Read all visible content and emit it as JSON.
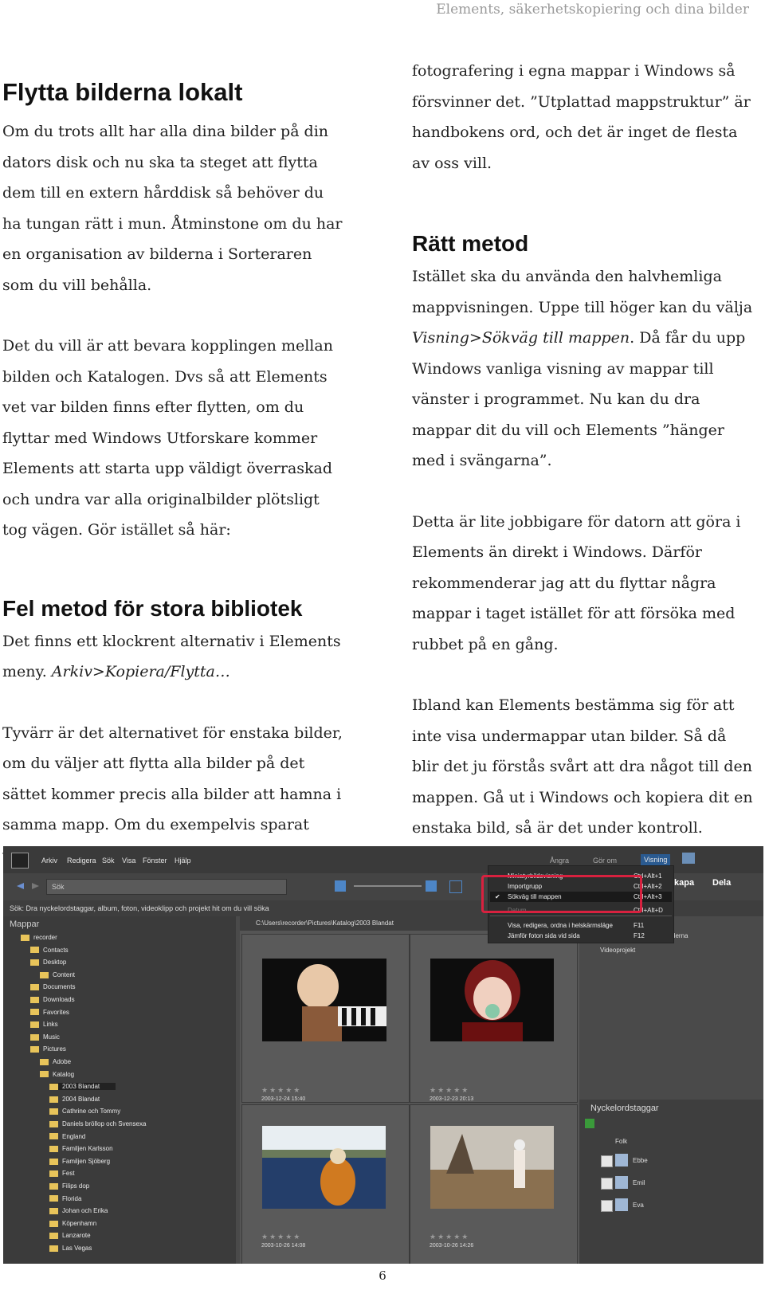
{
  "running_head": "Elements, säkerhetskopiering och dina bilder",
  "left": {
    "h1": "Flytta bilderna lokalt",
    "p1": "Om du trots allt har alla dina bilder på din dators disk och nu ska ta steget att flytta dem till en extern hårddisk så behöver du ha tungan rätt i mun. Åtminstone om du har en organisation av bilderna i Sorteraren som du vill behålla.",
    "p2": "Det du vill är att bevara kopplingen mellan bilden och Katalogen. Dvs så att Elements vet var bilden finns efter flytten, om du flyttar med Windows Utforskare kommer Elements att starta upp väldigt överraskad och undra var alla originalbilder plötsligt tog vägen. Gör istället så här:",
    "h2": "Fel metod för stora bibliotek",
    "p3a": "Det finns ett klockrent alternativ i Elements meny. ",
    "p3b": "Arkiv>Kopiera/Flytta…",
    "p4": "Tyvärr är det alternativet för enstaka bilder, om du väljer att flytta alla bilder på det sättet kommer precis alla bilder att hamna i samma mapp. Om du exempelvis sparat varje"
  },
  "right": {
    "p1": "fotografering i egna mappar i Windows så försvinner det. ”Utplattad mappstruktur” är handbokens ord, och det är inget de flesta av oss vill.",
    "h2": "Rätt metod",
    "p2a": "Istället ska du använda den halvhemliga mappvisningen. Uppe till höger kan du välja ",
    "p2b": "Visning>Sökväg till mappen",
    "p2c": ". Då får du upp Windows vanliga visning av mappar till vänster i programmet. Nu kan du dra mappar dit du vill och Elements ”hänger med i svängarna”.",
    "p3": "Detta är lite jobbigare för datorn att göra i Elements än direkt i Windows. Därför rekommenderar jag att du flyttar några mappar i taget istället för att försöka med rubbet på en gång.",
    "p4": "Ibland kan Elements bestämma sig för att inte visa undermappar utan bilder. Så då blir det ju förstås svårt att dra något till den mappen. Gå ut i Windows och kopiera dit en enstaka bild, så är det under kontroll."
  },
  "screenshot": {
    "menu": [
      "Arkiv",
      "Redigera",
      "Sök",
      "Visa",
      "Fönster",
      "Hjälp"
    ],
    "undo": "Ångra",
    "redo": "Gör om",
    "view_menu": "Visning",
    "search_placeholder": "Sök",
    "hint": "Sök: Dra nyckelordstaggar, album, foton, videoklipp och projekt hit om du vill söka",
    "folders_title": "Mappar",
    "path": "C:\\Users\\recorder\\Pictures\\Katalog\\2003 Blandat",
    "tree": [
      "recorder",
      "Contacts",
      "Desktop",
      "Content",
      "Documents",
      "Downloads",
      "Favorites",
      "Links",
      "Music",
      "Pictures",
      "Adobe",
      "Katalog",
      "2003 Blandat",
      "2004 Blandat",
      "Cathrine och Tommy",
      "Daniels bröllop och Svensexa",
      "England",
      "Familjen Karlsson",
      "Familjen Sjöberg",
      "Fest",
      "Filips dop",
      "Florida",
      "Johan och Erika",
      "Köpenhamn",
      "Lanzarote",
      "Las Vegas"
    ],
    "dropdown": [
      {
        "label": "Miniatyrbildsvisning",
        "shortcut": "Ctrl+Alt+1"
      },
      {
        "label": "Importgrupp",
        "shortcut": "Ctrl+Alt+2"
      },
      {
        "label": "Sökväg till mappen",
        "shortcut": "Ctrl+Alt+3"
      },
      {
        "label": "Datum",
        "shortcut": "Ctrl+Alt+D"
      },
      {
        "label": "Visa, redigera, ordna i helskärmsläge",
        "shortcut": "F11"
      },
      {
        "label": "Jämför foton sida vid sida",
        "shortcut": "F12"
      }
    ],
    "tab_create": "kapa",
    "tab_share": "Dela",
    "right_item1": "derna",
    "right_item2": "Videoprojekt",
    "photo_dates": [
      "2003-12-24 15:40",
      "2003-12-23 20:13",
      "2003-10-26 14:08",
      "2003-10-26 14:26"
    ],
    "keyword_header": "Nyckelordstaggar",
    "keyword_group": "Folk",
    "keywords": [
      "Ebbe",
      "Emil",
      "Eva"
    ]
  },
  "page_number": "6"
}
